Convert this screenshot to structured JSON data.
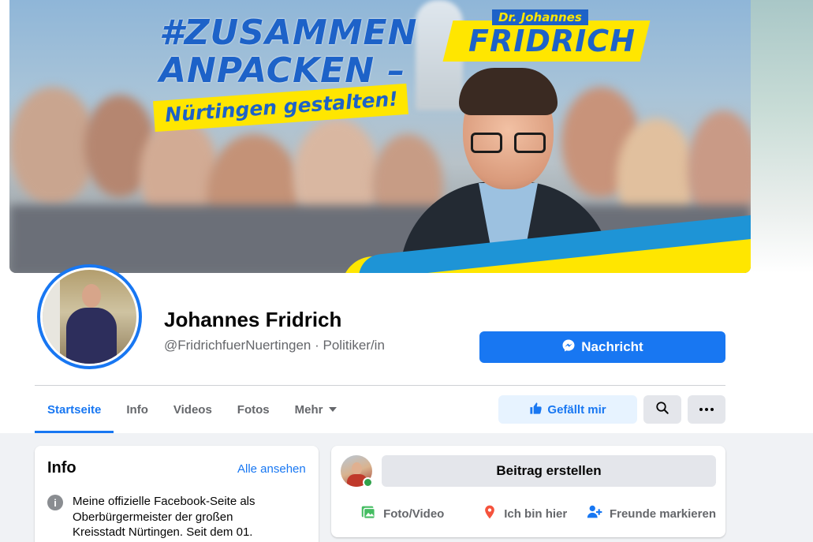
{
  "cover": {
    "headline_1": "#ZUSAMMEN",
    "headline_2": "ANPACKEN –",
    "tagline": "Nürtingen gestalten!",
    "name_small": "Dr. Johannes",
    "name_big": "FRIDRICH"
  },
  "profile": {
    "name": "Johannes Fridrich",
    "handle": "@FridrichfuerNuertingen",
    "separator": " · ",
    "category": "Politiker/in"
  },
  "actions": {
    "message_label": "Nachricht",
    "like_label": "Gefällt mir"
  },
  "tabs": [
    {
      "label": "Startseite",
      "active": true
    },
    {
      "label": "Info",
      "active": false
    },
    {
      "label": "Videos",
      "active": false
    },
    {
      "label": "Fotos",
      "active": false
    },
    {
      "label": "Mehr",
      "active": false
    }
  ],
  "info_card": {
    "title": "Info",
    "see_all": "Alle ansehen",
    "text": "Meine offizielle Facebook-Seite als Oberbürgermeister der großen Kreisstadt Nürtingen. Seit dem 01."
  },
  "post_card": {
    "create_label": "Beitrag erstellen",
    "actions": [
      {
        "label": "Foto/Video",
        "icon": "photo-video-icon",
        "color": "#45bd62"
      },
      {
        "label": "Ich bin hier",
        "icon": "location-pin-icon",
        "color": "#f5533d"
      },
      {
        "label": "Freunde markieren",
        "icon": "tag-friends-icon",
        "color": "#1877f2"
      }
    ]
  },
  "colors": {
    "accent": "#1877f2",
    "banner_yellow": "#ffe600",
    "banner_blue": "#1d62c8",
    "online": "#31a24c"
  }
}
